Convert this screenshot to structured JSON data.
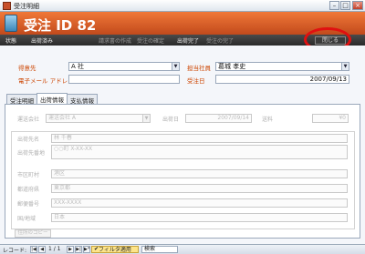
{
  "window": {
    "title": "受注明細"
  },
  "header": {
    "title": "受注 ID 82"
  },
  "status": {
    "label": "状態",
    "value": "出荷済み",
    "actions": [
      "請求書の作成",
      "受注の確定",
      "出荷完了",
      "受注の完了"
    ],
    "close": "閉じる"
  },
  "form": {
    "customer_label": "得意先",
    "customer_value": "A 社",
    "email_label": "電子メール アドレス",
    "email_value": "",
    "employee_label": "担当社員",
    "employee_value": "葛城 孝史",
    "order_date_label": "受注日",
    "order_date_value": "2007/09/13"
  },
  "tabs": [
    "受注明細",
    "出荷情報",
    "支払情報"
  ],
  "shipping": {
    "shipper_label": "運送会社",
    "shipper_value": "運送会社 A",
    "ship_date_label": "出荷日",
    "ship_date_value": "2007/09/14",
    "fee_label": "送料",
    "fee_value": "¥0",
    "name_label": "出荷先名",
    "name_value": "林 千春",
    "street_label": "出荷先番地",
    "street_value": "○○町 X-XX-XX",
    "city_label": "市区町村",
    "city_value": "港区",
    "pref_label": "都道府県",
    "pref_value": "東京都",
    "zip_label": "郵便番号",
    "zip_value": "XXX-XXXX",
    "country_label": "国/地域",
    "country_value": "日本",
    "copy_button": "住所のコピー"
  },
  "recnav": {
    "label": "レコード:",
    "position": "1 / 1",
    "filter": "フィルタ適用",
    "search": "検索"
  }
}
